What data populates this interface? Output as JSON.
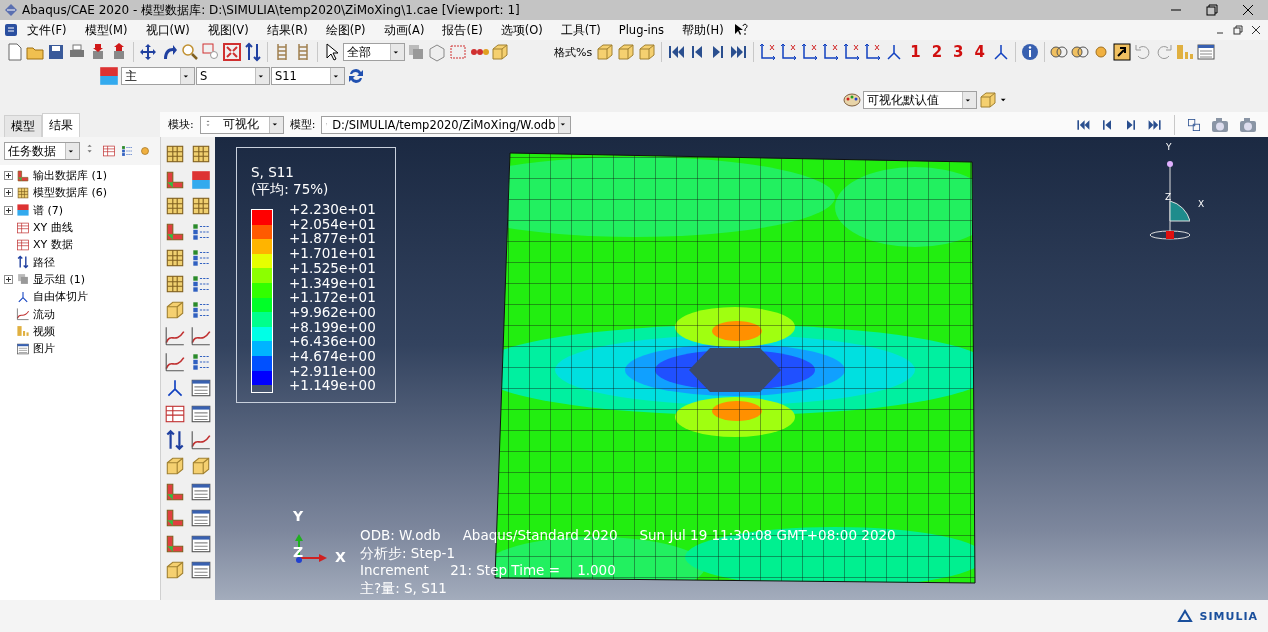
{
  "window": {
    "title": "Abaqus/CAE 2020 - 模型数据库: D:\\SIMULIA\\temp2020\\ZiMoXing\\1.cae [Viewport: 1]"
  },
  "menu": [
    "文件(F)",
    "模型(M)",
    "视口(W)",
    "视图(V)",
    "结果(R)",
    "绘图(P)",
    "动画(A)",
    "报告(E)",
    "选项(O)",
    "工具(T)",
    "Plug-ins",
    "帮助(H)"
  ],
  "toolbar": {
    "selection_filter": "全部",
    "format_label": "格式%s",
    "view_numbers": [
      "1",
      "2",
      "3",
      "4"
    ]
  },
  "field_output": {
    "position": "主",
    "variable": "S",
    "component": "S11"
  },
  "color_scheme": {
    "value": "可视化默认值"
  },
  "tabs": [
    {
      "label": "模型",
      "selected": false
    },
    {
      "label": "结果",
      "selected": true
    }
  ],
  "context": {
    "module_label": "模块:",
    "module": "可视化",
    "model_label": "模型:",
    "model": "D:/SIMULIA/temp2020/ZiMoXing/W.odb"
  },
  "tree": {
    "filter": "任务数据",
    "items": [
      {
        "label": "输出数据库 (1)",
        "kind": "group"
      },
      {
        "label": "模型数据库 (6)",
        "kind": "group"
      },
      {
        "label": "谱 (7)",
        "kind": "group"
      },
      {
        "label": "XY 曲线",
        "kind": "leaf"
      },
      {
        "label": "XY 数据",
        "kind": "leaf"
      },
      {
        "label": "路径",
        "kind": "leaf"
      },
      {
        "label": "显示组 (1)",
        "kind": "group"
      },
      {
        "label": "自由体切片",
        "kind": "leaf"
      },
      {
        "label": "流动",
        "kind": "leaf"
      },
      {
        "label": "视频",
        "kind": "leaf"
      },
      {
        "label": "图片",
        "kind": "leaf"
      }
    ]
  },
  "legend": {
    "title": "S, S11",
    "subtitle": "(平均: 75%)",
    "values": [
      "+2.230e+01",
      "+2.054e+01",
      "+1.877e+01",
      "+1.701e+01",
      "+1.525e+01",
      "+1.349e+01",
      "+1.172e+01",
      "+9.962e+00",
      "+8.199e+00",
      "+6.436e+00",
      "+4.674e+00",
      "+2.911e+00",
      "+1.149e+00"
    ],
    "bands": [
      {
        "color": "#ff0000"
      },
      {
        "color": "#ff5a00"
      },
      {
        "color": "#ffb400"
      },
      {
        "color": "#e6ff00"
      },
      {
        "color": "#8cff00"
      },
      {
        "color": "#32ff00"
      },
      {
        "color": "#00ff28"
      },
      {
        "color": "#00ff8c"
      },
      {
        "color": "#00ffe6"
      },
      {
        "color": "#00b4ff"
      },
      {
        "color": "#0050ff"
      },
      {
        "color": "#0000ff"
      }
    ]
  },
  "view_triad": {
    "y": "Y",
    "z": "Z",
    "x": "X"
  },
  "viewport_info": {
    "line_1": [
      "ODB: W.odb",
      "Abaqus/Standard 2020",
      "Sun Jul 19 11:30:08 GMT+08:00 2020"
    ],
    "step": "分析步: Step-1",
    "increment": "Increment     21: Step Time =    1.000",
    "variable": "主?量: S, S11"
  },
  "axis_triad": {
    "y": "Y",
    "z": "Z",
    "x": "X"
  },
  "logo": "SIMULIA"
}
